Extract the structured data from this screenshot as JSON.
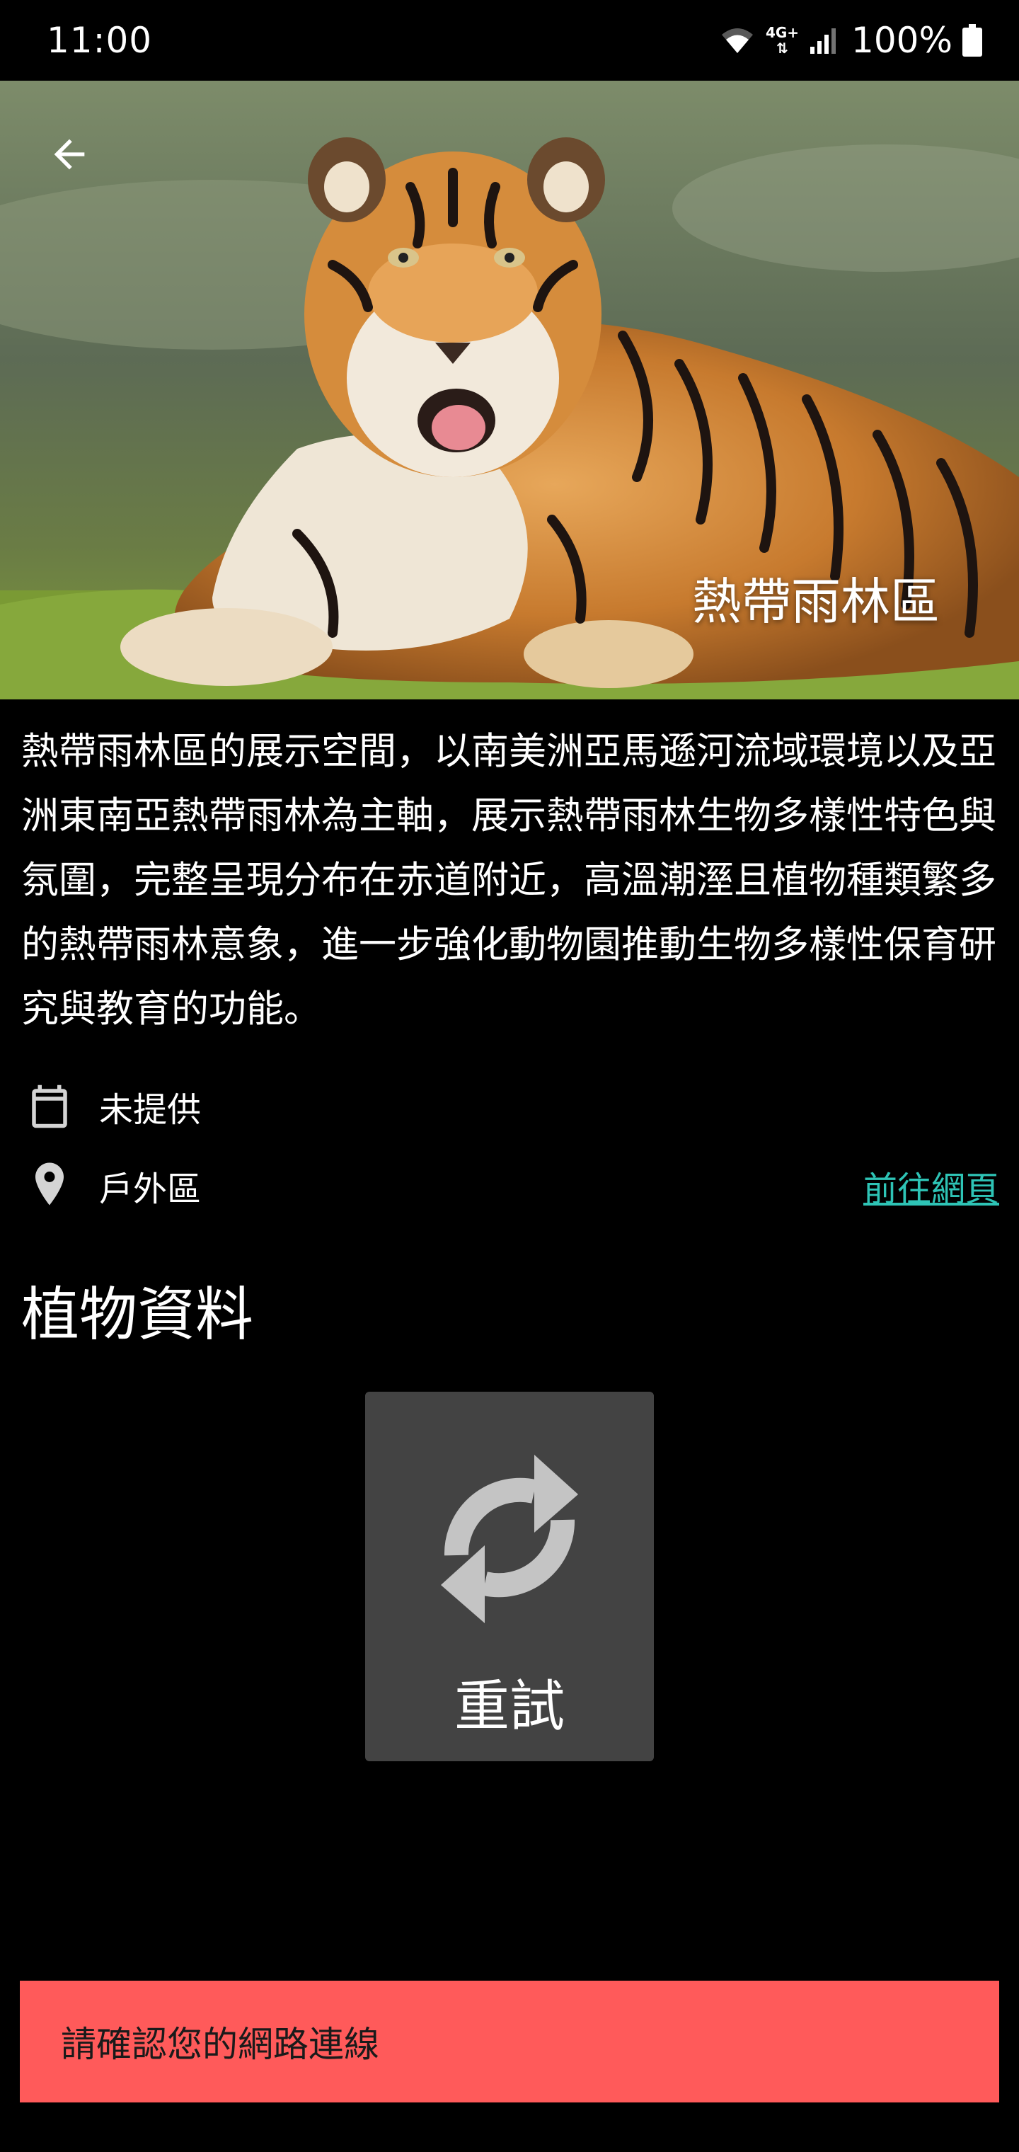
{
  "status_bar": {
    "time": "11:00",
    "network_type": "4G+",
    "battery_percent": "100%",
    "icons": [
      "wifi-icon",
      "data-arrows-icon",
      "signal-icon",
      "battery-icon"
    ]
  },
  "hero": {
    "title": "熱帶雨林區",
    "back_icon": "arrow-left-icon",
    "image_subject": "tiger-photo"
  },
  "description": "熱帶雨林區的展示空間，以南美洲亞馬遜河流域環境以及亞洲東南亞熱帶雨林為主軸，展示熱帶雨林生物多樣性特色與氛圍，完整呈現分布在赤道附近，高溫潮溼且植物種類繁多的熱帶雨林意象，進一步強化動物園推動生物多樣性保育研究與教育的功能。",
  "info": {
    "date_icon": "calendar-icon",
    "date_text": "未提供",
    "location_icon": "location-pin-icon",
    "location_text": "戶外區",
    "web_link": "前往網頁"
  },
  "plants_section": {
    "title": "植物資料"
  },
  "retry": {
    "icon": "refresh-icon",
    "label": "重試"
  },
  "snackbar": {
    "message": "請確認您的網路連線"
  },
  "colors": {
    "background": "#000000",
    "link": "#2ec4b6",
    "retry_bg": "#434343",
    "snackbar_bg": "#ff5a5a",
    "snackbar_text": "#1a1a1a"
  }
}
